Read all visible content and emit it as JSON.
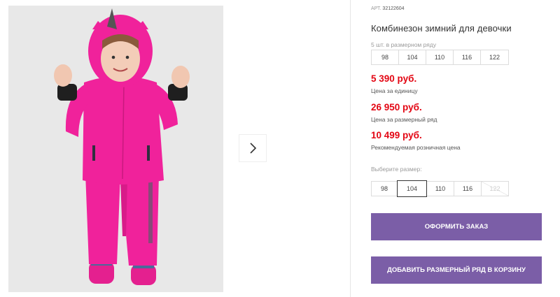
{
  "article": {
    "label": "АРТ.",
    "value": "32122604"
  },
  "product": {
    "title": "Комбинезон зимний для девочки"
  },
  "size_row": {
    "label": "5 шт. в размерном ряду",
    "sizes": [
      "98",
      "104",
      "110",
      "116",
      "122"
    ]
  },
  "prices": {
    "unit": {
      "value": "5 390 руб.",
      "note": "Цена за единицу"
    },
    "row": {
      "value": "26 950 руб.",
      "note": "Цена за размерный ряд"
    },
    "retail": {
      "value": "10 499 руб.",
      "note": "Рекомендуемая розничная цена"
    }
  },
  "size_select": {
    "label": "Выберите размер:",
    "options": [
      {
        "label": "98",
        "state": "available"
      },
      {
        "label": "104",
        "state": "selected"
      },
      {
        "label": "110",
        "state": "available"
      },
      {
        "label": "116",
        "state": "available"
      },
      {
        "label": "122",
        "state": "disabled"
      }
    ]
  },
  "actions": {
    "order": "ОФОРМИТЬ ЗАКАЗ",
    "add_row": "ДОБАВИТЬ РАЗМЕРНЫЙ РЯД В КОРЗИНУ"
  },
  "colors": {
    "accent": "#7b5ea7",
    "price": "#e30613",
    "suit": "#f0229b"
  },
  "icons": {
    "next": "chevron-right-icon"
  }
}
